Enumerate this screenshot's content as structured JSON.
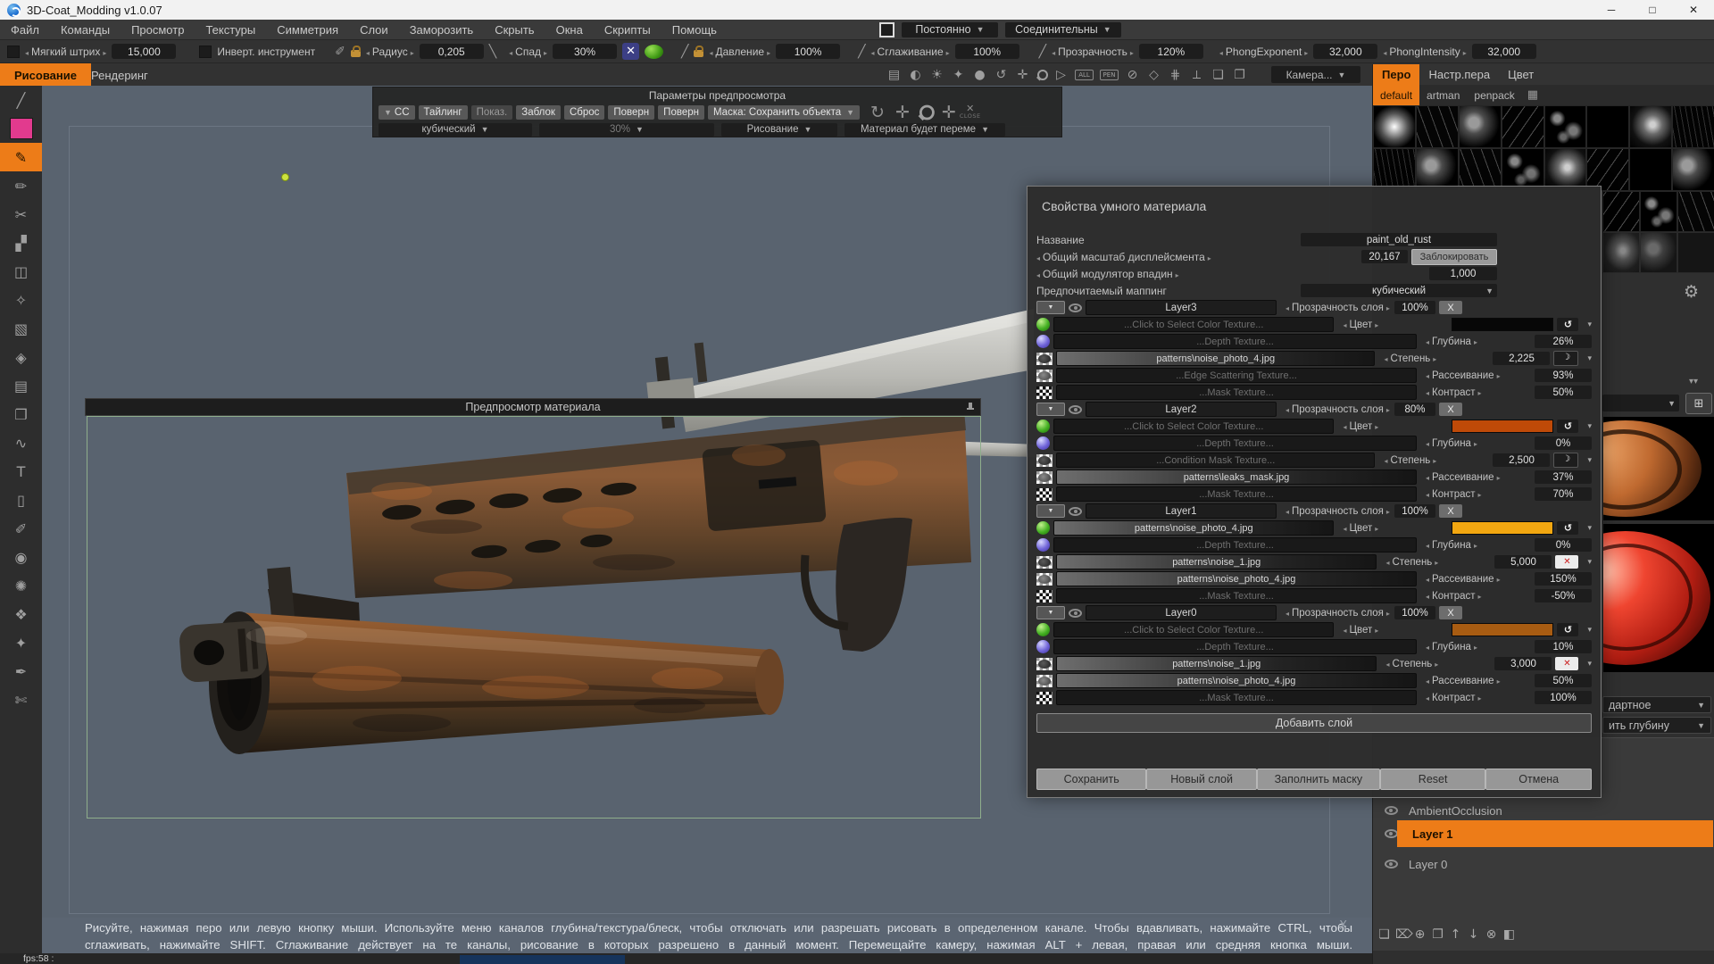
{
  "window": {
    "title": "3D-Coat_Modding v1.0.07",
    "controls": {
      "minimize": "─",
      "maximize": "□",
      "close": "✕"
    }
  },
  "menu": {
    "items": [
      "Файл",
      "Команды",
      "Просмотр",
      "Текстуры",
      "Симметрия",
      "Слои",
      "Заморозить",
      "Скрыть",
      "Окна",
      "Скрипты",
      "Помощь"
    ],
    "persist_dropdown": "Постоянно",
    "connective_dropdown": "Соединительны"
  },
  "toolbar": {
    "soft_stroke_label": "Мягкий штрих",
    "soft_stroke_value": "15,000",
    "invert_label": "Инверт.  инструмент",
    "radius_label": "Радиус",
    "radius_value": "0,205",
    "falloff_label": "Спад",
    "falloff_value": "30%",
    "pressure_label": "Давление",
    "pressure_value": "100%",
    "smoothing_label": "Сглаживание",
    "smoothing_value": "100%",
    "opacity_label": "Прозрачность",
    "opacity_value": "120%",
    "phong_exponent_label": "PhongExponent",
    "phong_exponent_value": "32,000",
    "phong_intensity_label": "PhongIntensity",
    "phong_intensity_value": "32,000",
    "camera_label": "Камера...",
    "view_icons": [
      {
        "name": "frame-icon",
        "glyph": "▤"
      },
      {
        "name": "contrast-icon",
        "glyph": "◐"
      },
      {
        "name": "light-icon",
        "glyph": "☀"
      },
      {
        "name": "sparkle-icon",
        "glyph": "✦"
      },
      {
        "name": "drop-icon",
        "glyph": "●"
      },
      {
        "name": "rotate-icon",
        "glyph": "↺"
      },
      {
        "name": "move-icon",
        "glyph": "✛"
      },
      {
        "name": "magnify-icon",
        "glyph": "MAG"
      },
      {
        "name": "play-icon",
        "glyph": "▷"
      },
      {
        "name": "select-all-icon",
        "glyph": "ALL"
      },
      {
        "name": "pen-select-icon",
        "glyph": "PEN"
      },
      {
        "name": "block-icon",
        "glyph": "⊘"
      },
      {
        "name": "cube-icon",
        "glyph": "◇"
      },
      {
        "name": "grid-icon",
        "glyph": "⋕"
      },
      {
        "name": "axis-icon",
        "glyph": "⟂"
      },
      {
        "name": "expand-icon",
        "glyph": "❏"
      },
      {
        "name": "layers-icon",
        "glyph": "❐"
      }
    ]
  },
  "mode_tabs": {
    "paint": "Рисование",
    "render": "Рендеринг"
  },
  "left_toolbar": {
    "tools": [
      {
        "name": "line-tool",
        "glyph": "╱"
      },
      {
        "name": "color-swatch",
        "swatch": true,
        "color": "#e23a8e"
      },
      {
        "name": "brush-tool",
        "glyph": "✎",
        "selected": true
      },
      {
        "name": "pencil-tool",
        "glyph": "✏"
      },
      {
        "name": "cut-tool",
        "glyph": "✂"
      },
      {
        "name": "shade-tool",
        "glyph": "▞"
      },
      {
        "name": "eraser-tool",
        "glyph": "◫"
      },
      {
        "name": "airbrush-tool",
        "glyph": "✧"
      },
      {
        "name": "roller-tool",
        "glyph": "▧"
      },
      {
        "name": "stamp-tool",
        "glyph": "◈"
      },
      {
        "name": "image-tool",
        "glyph": "▤"
      },
      {
        "name": "pages-tool",
        "glyph": "❐"
      },
      {
        "name": "curve-tool",
        "glyph": "∿"
      },
      {
        "name": "text-tool",
        "glyph": "T"
      },
      {
        "name": "frame-tool",
        "glyph": "▯"
      },
      {
        "name": "paint-tool",
        "glyph": "✐"
      },
      {
        "name": "eye-tool",
        "glyph": "◉"
      },
      {
        "name": "burst-tool",
        "glyph": "✺"
      },
      {
        "name": "facet-tool",
        "glyph": "❖"
      },
      {
        "name": "picker-tool",
        "glyph": "✦"
      },
      {
        "name": "pen-tool",
        "glyph": "✒"
      },
      {
        "name": "scissors-tool",
        "glyph": "✄"
      }
    ]
  },
  "preview_params": {
    "title": "Параметры предпросмотра",
    "buttons": [
      {
        "label": "CC",
        "caret": true
      },
      {
        "label": "Тайлинг"
      },
      {
        "label": "Показ.",
        "dim": true
      },
      {
        "label": "Заблок"
      },
      {
        "label": "Сброс"
      },
      {
        "label": "Поверн"
      },
      {
        "label": "Поверн"
      }
    ],
    "mask_dropdown": "Маска:  Сохранить  объекта",
    "icons": [
      {
        "name": "rotate-icon",
        "glyph": "↻"
      },
      {
        "name": "move-icon",
        "glyph": "✛"
      },
      {
        "name": "magnify-icon",
        "glyph": "MAG"
      },
      {
        "name": "pan-icon",
        "glyph": "✛"
      }
    ],
    "close_label": "CLOSE",
    "mapping_value": "кубический",
    "percent_value": "30%",
    "mode_value": "Рисование",
    "material_value": "Материал  будет  переме"
  },
  "material_preview": {
    "title": "Предпросмотр  материала"
  },
  "dialog": {
    "title": "Свойства  умного  материала",
    "name_label": "Название",
    "name_value": "paint_old_rust",
    "displacement_label": "Общий  масштаб  дисплейсмента",
    "displacement_value": "20,167",
    "lock_button": "Заблокировать",
    "cavity_label": "Общий  модулятор  впадин",
    "cavity_value": "1,000",
    "mapping_label": "Предпочитаемый  маппинг",
    "mapping_value": "кубический",
    "opacity_label": "Прозрачность  слоя",
    "add_layer": "Добавить  слой",
    "buttons": [
      "Сохранить",
      "Новый  слой",
      "Заполнить  маску",
      "Reset",
      "Отмена"
    ],
    "layers": [
      {
        "name": "Layer3",
        "opacity": "100%",
        "rows": [
          {
            "icon": "green-ball",
            "kind": "color",
            "text": "...Click  to  Select  Color  Texture...",
            "file": false,
            "param": "Цвет",
            "color": "#070707"
          },
          {
            "icon": "blue-ball",
            "kind": "value",
            "text": "...Depth  Texture...",
            "file": false,
            "param": "Глубина",
            "value": "26%"
          },
          {
            "icon": "photo",
            "kind": "value",
            "text": "patterns\\noise_photo_4.jpg",
            "file": true,
            "param": "Степень",
            "value": "2,225",
            "extra": "moon"
          },
          {
            "icon": "photo-dim",
            "kind": "value",
            "text": "...Edge  Scattering  Texture...",
            "file": false,
            "param": "Рассеивание",
            "value": "93%"
          },
          {
            "icon": "checker",
            "kind": "value",
            "text": "...Mask  Texture...",
            "file": false,
            "param": "Контраст",
            "value": "50%"
          }
        ]
      },
      {
        "name": "Layer2",
        "opacity": "80%",
        "rows": [
          {
            "icon": "green-ball",
            "kind": "color",
            "text": "...Click  to  Select  Color  Texture...",
            "file": false,
            "param": "Цвет",
            "color": "#bf4a08"
          },
          {
            "icon": "blue-ball",
            "kind": "value",
            "text": "...Depth  Texture...",
            "file": false,
            "param": "Глубина",
            "value": "0%"
          },
          {
            "icon": "photo",
            "kind": "value",
            "text": "...Condition  Mask  Texture...",
            "file": false,
            "param": "Степень",
            "value": "2,500",
            "extra": "moon"
          },
          {
            "icon": "photo-dim",
            "kind": "value",
            "text": "patterns\\leaks_mask.jpg",
            "file": true,
            "param": "Рассеивание",
            "value": "37%"
          },
          {
            "icon": "checker",
            "kind": "value",
            "text": "...Mask  Texture...",
            "file": false,
            "param": "Контраст",
            "value": "70%"
          }
        ]
      },
      {
        "name": "Layer1",
        "opacity": "100%",
        "rows": [
          {
            "icon": "green-ball",
            "kind": "color",
            "text": "patterns\\noise_photo_4.jpg",
            "file": true,
            "param": "Цвет",
            "color": "#f2a711"
          },
          {
            "icon": "blue-ball",
            "kind": "value",
            "text": "...Depth  Texture...",
            "file": false,
            "param": "Глубина",
            "value": "0%"
          },
          {
            "icon": "photo",
            "kind": "value",
            "text": "patterns\\noise_1.jpg",
            "file": true,
            "param": "Степень",
            "value": "5,000",
            "extra": "redx"
          },
          {
            "icon": "photo-dim",
            "kind": "value",
            "text": "patterns\\noise_photo_4.jpg",
            "file": true,
            "param": "Рассеивание",
            "value": "150%"
          },
          {
            "icon": "checker",
            "kind": "value",
            "text": "...Mask  Texture...",
            "file": false,
            "param": "Контраст",
            "value": "-50%"
          }
        ]
      },
      {
        "name": "Layer0",
        "opacity": "100%",
        "rows": [
          {
            "icon": "green-ball",
            "kind": "color",
            "text": "...Click  to  Select  Color  Texture...",
            "file": false,
            "param": "Цвет",
            "color": "#a85c12"
          },
          {
            "icon": "blue-ball",
            "kind": "value",
            "text": "...Depth  Texture...",
            "file": false,
            "param": "Глубина",
            "value": "10%"
          },
          {
            "icon": "photo",
            "kind": "value",
            "text": "patterns\\noise_1.jpg",
            "file": true,
            "param": "Степень",
            "value": "3,000",
            "extra": "redx"
          },
          {
            "icon": "photo-dim",
            "kind": "value",
            "text": "patterns\\noise_photo_4.jpg",
            "file": true,
            "param": "Рассеивание",
            "value": "50%"
          },
          {
            "icon": "checker",
            "kind": "value",
            "text": "...Mask  Texture...",
            "file": false,
            "param": "Контраст",
            "value": "100%"
          }
        ]
      }
    ]
  },
  "right_panel": {
    "tabs": [
      "Перо",
      "Настр.пера",
      "Цвет"
    ],
    "pen_tabs": [
      "default",
      "artman",
      "penpack"
    ],
    "strip": {
      "partial_dropdown_1": "дартное",
      "partial_dropdown_2": "ить  глубину"
    },
    "layers_list": {
      "items": [
        "AmbientOcclusion",
        "Layer  1",
        "Layer  0"
      ],
      "selected": "Layer  1"
    },
    "layer_ops": [
      {
        "name": "new-layer-icon",
        "glyph": "❏"
      },
      {
        "name": "delete-layer-icon",
        "glyph": "⌦"
      },
      {
        "name": "import-layer-icon",
        "glyph": "⊕"
      },
      {
        "name": "duplicate-layer-icon",
        "glyph": "❐"
      },
      {
        "name": "move-up-icon",
        "glyph": "↑"
      },
      {
        "name": "move-down-icon",
        "glyph": "↓"
      },
      {
        "name": "clear-layer-icon",
        "glyph": "⊗"
      },
      {
        "name": "folder-icon",
        "glyph": "◧"
      }
    ]
  },
  "status": {
    "line1": "Рисуйте, нажимая перо или левую кнопку мыши. Используйте меню каналов глубина/текстура/блеск, чтобы отключать или разрешать рисовать в определенном канале. Чтобы вдавливать, нажимайте CTRL, чтобы",
    "line2": "сглаживать, нажимайте SHIFT. Сглаживание действует на те каналы, рисование в которых разрешено в данный момент. Перемещайте камеру, нажимая ALT + левая, правая или средняя кнопка мыши.",
    "fps": "fps:58 :"
  },
  "colors": {
    "accent": "#ed7c18",
    "viewport": "#59636f",
    "preview_border": "#8fae8c",
    "swatch_layer3": "#070707",
    "swatch_layer2": "#bf4a08",
    "swatch_layer1": "#f2a711",
    "swatch_layer0": "#a85c12",
    "current_color": "#e23a8e"
  }
}
